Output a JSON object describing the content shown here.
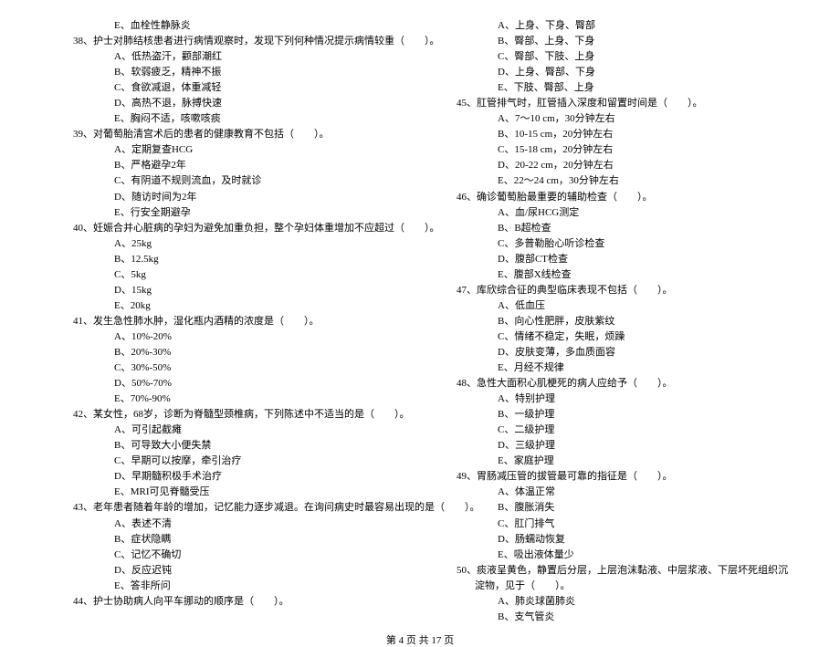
{
  "left": {
    "e37": "E、血栓性静脉炎",
    "q38": "38、护士对肺结核患者进行病情观察时，发现下列何种情况提示病情较重（　　）。",
    "a38": "A、低热盗汗，颧部潮红",
    "b38": "B、软弱疲乏，精神不振",
    "c38": "C、食欲减退，体重减轻",
    "d38": "D、高热不退，脉搏快速",
    "e38": "E、胸闷不适，咳嗽咳痰",
    "q39": "39、对葡萄胎清宫术后的患者的健康教育不包括（　　）。",
    "a39": "A、定期复查HCG",
    "b39": "B、严格避孕2年",
    "c39": "C、有阴道不规则流血，及时就诊",
    "d39": "D、随访时间为2年",
    "e39": "E、行安全期避孕",
    "q40": "40、妊娠合并心脏病的孕妇为避免加重负担，整个孕妇体重增加不应超过（　　）。",
    "a40": "A、25kg",
    "b40": "B、12.5kg",
    "c40": "C、5kg",
    "d40": "D、15kg",
    "e40": "E、20kg",
    "q41": "41、发生急性肺水肿，湿化瓶内酒精的浓度是（　　）。",
    "a41": "A、10%-20%",
    "b41": "B、20%-30%",
    "c41": "C、30%-50%",
    "d41": "D、50%-70%",
    "e41": "E、70%-90%",
    "q42": "42、某女性，68岁，诊断为脊髓型颈椎病，下列陈述中不适当的是（　　）。",
    "a42": "A、可引起截瘫",
    "b42": "B、可导致大小便失禁",
    "c42": "C、早期可以按摩，牵引治疗",
    "d42": "D、早期髓积极手术治疗",
    "e42": "E、MRI可见脊髓受压",
    "blank42": "",
    "q43": "43、老年患者随着年龄的增加，记忆能力逐步减退。在询问病史时最容易出现的是（　　）。",
    "a43": "A、表述不清",
    "b43": "B、症状隐瞒",
    "c43": "C、记忆不确切",
    "d43": "D、反应迟钝",
    "e43": "E、答非所问",
    "q44": "44、护士协助病人向平车挪动的顺序是（　　）。"
  },
  "right": {
    "a44": "A、上身、下身、臀部",
    "b44": "B、臀部、上身、下身",
    "c44": "C、臀部、下肢、上身",
    "d44": "D、上身、臀部、下身",
    "e44": "E、下肢、臀部、上身",
    "q45": "45、肛管排气时，肛管插入深度和留置时间是（　　）。",
    "a45": "A、7～10 cm，30分钟左右",
    "b45": "B、10-15 cm，20分钟左右",
    "c45": "C、15-18 cm，20分钟左右",
    "d45": "D、20-22 cm，20分钟左右",
    "e45": "E、22～24 cm，30分钟左右",
    "q46": "46、确诊葡萄胎最重要的辅助检查（　　）。",
    "a46": "A、血/尿HCG测定",
    "b46": "B、B超检查",
    "c46": "C、多普勒胎心听诊检查",
    "d46": "D、腹部CT检查",
    "e46": "E、腹部X线检查",
    "q47": "47、库欣综合征的典型临床表现不包括（　　）。",
    "a47": "A、低血压",
    "b47": "B、向心性肥胖，皮肤紫纹",
    "c47": "C、情绪不稳定，失眠，烦躁",
    "d47": "D、皮肤变薄，多血质面容",
    "e47": "E、月经不规律",
    "q48": "48、急性大面积心肌梗死的病人应给予（　　）。",
    "a48": "A、特别护理",
    "b48": "B、一级护理",
    "c48": "C、二级护理",
    "d48": "D、三级护理",
    "e48": "E、家庭护理",
    "q49": "49、胃肠减压管的拔管最可靠的指征是（　　）。",
    "a49": "A、体温正常",
    "b49": "B、腹胀消失",
    "c49": "C、肛门排气",
    "d49": "D、肠蠕动恢复",
    "e49": "E、吸出液体量少",
    "q50": "50、痰液呈黄色，静置后分层，上层泡沫黏液、中层浆液、下层坏死组织沉淀物，见于（　　）。",
    "a50": "A、肺炎球菌肺炎",
    "b50": "B、支气管炎"
  },
  "footer": "第 4 页 共 17 页"
}
